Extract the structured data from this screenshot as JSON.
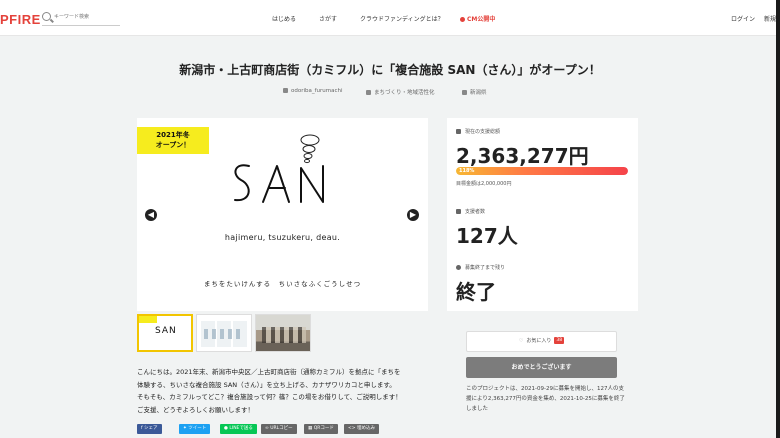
{
  "header": {
    "logo": "PFIRE",
    "search_placeholder": "キーワード検索",
    "nav": [
      "はじめる",
      "さがす",
      "クラウドファンディングとは？",
      "CM公開中"
    ],
    "login": "ログイン",
    "signup": "新規"
  },
  "project": {
    "title": "新潟市・上古町商店街（カミフル）に「複合施設 SAN（さん）」がオープン！",
    "owner": "odoriba_furumachi",
    "category": "まちづくり・地域活性化",
    "location": "新潟県"
  },
  "hero": {
    "banner_line1": "2021年冬",
    "banner_line2": "オープン！",
    "logo_word": "SAN",
    "tagline": "hajimeru, tsuzukeru, deau.",
    "subline": "まちをたいけんする　ちいさなふくごうしせつ"
  },
  "stats": {
    "total_label": "現在の支援総額",
    "total_value": "2,363,277円",
    "percent_label": "118%",
    "percent": 118,
    "goal": "目標金額は2,000,000円",
    "backers_label": "支援者数",
    "backers_value": "127人",
    "remaining_label": "募集終了まで残り",
    "remaining_value": "終了"
  },
  "actions": {
    "favorite": "お気に入り",
    "favorite_count": "38",
    "support": "おめでとうございます",
    "note": "このプロジェクトは、2021-09-29に募集を開始し、127人の支援により2,363,277円の資金を集め、2021-10-25に募集を終了しました"
  },
  "description": {
    "line1": "こんにちは。2021年末、新潟市中央区／上古町商店街（通称カミフル）を拠点に「まちを",
    "line2": "体験する、ちいさな複合施設 SAN（さん）」を立ち上げる、カナザワリカコと申します。",
    "line3": "そもそも、カミフルってどこ？複合施設って何？篠？この場をお借りして、ご説明します！",
    "line4": "ご支援、どうぞよろしくお願いします！"
  },
  "share": {
    "facebook": "シェア",
    "twitter": "ツイート",
    "line": "LINEで送る",
    "url": "URLコピー",
    "qr": "QRコード",
    "embed": "埋め込み"
  },
  "colors": {
    "brand": "#e4423b",
    "banner": "#f6ec1e",
    "support_button": "#7c7c7c"
  }
}
